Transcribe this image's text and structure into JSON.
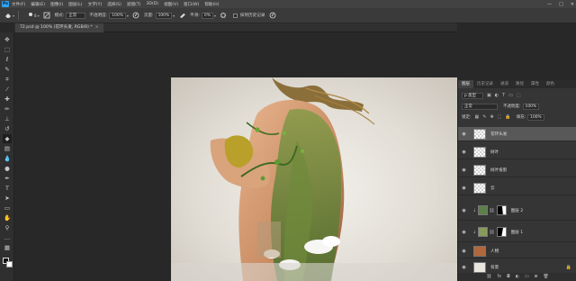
{
  "app": {
    "logo": "Ps"
  },
  "menubar": {
    "items": [
      "文件(F)",
      "编辑(E)",
      "图像(I)",
      "图层(L)",
      "文字(Y)",
      "选择(S)",
      "滤镜(T)",
      "3D(D)",
      "视图(V)",
      "窗口(W)",
      "帮助(H)"
    ],
    "window_controls": [
      "—",
      "□",
      "✕"
    ]
  },
  "options_bar": {
    "brush_size": "8",
    "mode_label": "模式:",
    "mode_value": "正常",
    "opacity_label": "不透明度:",
    "opacity_value": "100%",
    "flow_label": "流量:",
    "flow_value": "100%",
    "smoothing_label": "平滑:",
    "smoothing_value": "0%",
    "erase_history_label": "抹到历史记录"
  },
  "document": {
    "tab_label": "72.psd @ 100% (花环头发, RGB/8) *",
    "close": "×"
  },
  "layers_panel": {
    "tabs": [
      "图层",
      "历史记录",
      "通道",
      "路径",
      "属性",
      "颜色"
    ],
    "active_tab": 0,
    "filter_label": "p 类型",
    "blend_mode": "正常",
    "opacity_label": "不透明度:",
    "opacity_value": "100%",
    "lock_label": "锁定:",
    "fill_label": "填充:",
    "fill_value": "100%",
    "layers": [
      {
        "name": "花环头发",
        "selected": true,
        "type": "plain"
      },
      {
        "name": "树叶",
        "selected": false,
        "type": "plain"
      },
      {
        "name": "树叶投影",
        "selected": false,
        "type": "plain"
      },
      {
        "name": "云",
        "selected": false,
        "type": "plain"
      },
      {
        "name": "图层 2",
        "selected": false,
        "type": "masked"
      },
      {
        "name": "图层 1",
        "selected": false,
        "type": "masked"
      },
      {
        "name": "人物",
        "selected": false,
        "type": "photo"
      },
      {
        "name": "背景",
        "selected": false,
        "type": "background"
      }
    ],
    "bottom_icons": [
      "link-icon",
      "fx-icon",
      "mask-icon",
      "adjustment-icon",
      "group-icon",
      "new-layer-icon",
      "trash-icon"
    ]
  },
  "toolbar": {
    "tools": [
      "move-tool",
      "marquee-tool",
      "lasso-tool",
      "quick-select-tool",
      "crop-tool",
      "eyedropper-tool",
      "healing-tool",
      "brush-tool",
      "stamp-tool",
      "history-brush-tool",
      "eraser-tool",
      "gradient-tool",
      "blur-tool",
      "dodge-tool",
      "pen-tool",
      "type-tool",
      "path-select-tool",
      "shape-tool",
      "hand-tool",
      "zoom-tool",
      "more-tool"
    ],
    "active_tool_index": 10
  },
  "colors": {
    "accent": "#2fa2f0",
    "panel_bg": "#353535",
    "selected_layer": "#585858",
    "foreground_color": "#111111",
    "background_color": "#ffffff"
  }
}
